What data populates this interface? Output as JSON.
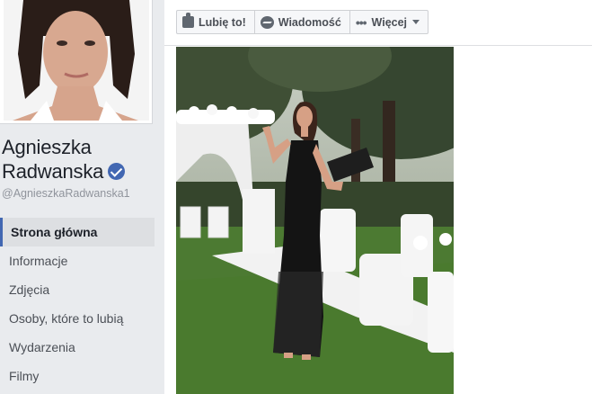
{
  "profile": {
    "name_line1": "Agnieszka",
    "name_line2": "Radwanska",
    "handle": "@AgnieszkaRadwanska1",
    "verified": true
  },
  "nav": {
    "items": [
      {
        "label": "Strona główna",
        "active": true
      },
      {
        "label": "Informacje",
        "active": false
      },
      {
        "label": "Zdjęcia",
        "active": false
      },
      {
        "label": "Osoby, które to lubią",
        "active": false
      },
      {
        "label": "Wydarzenia",
        "active": false
      },
      {
        "label": "Filmy",
        "active": false
      }
    ]
  },
  "actions": {
    "like_label": "Lubię to!",
    "message_label": "Wiadomość",
    "more_label": "Więcej"
  },
  "icons": {
    "like": "thumbs-up-icon",
    "message": "messenger-icon",
    "more": "more-dots-icon",
    "verified": "verified-badge-icon"
  },
  "colors": {
    "sidebar_bg": "#e9ebee",
    "accent": "#4267b2",
    "text_primary": "#1d2129",
    "text_secondary": "#90949c"
  }
}
